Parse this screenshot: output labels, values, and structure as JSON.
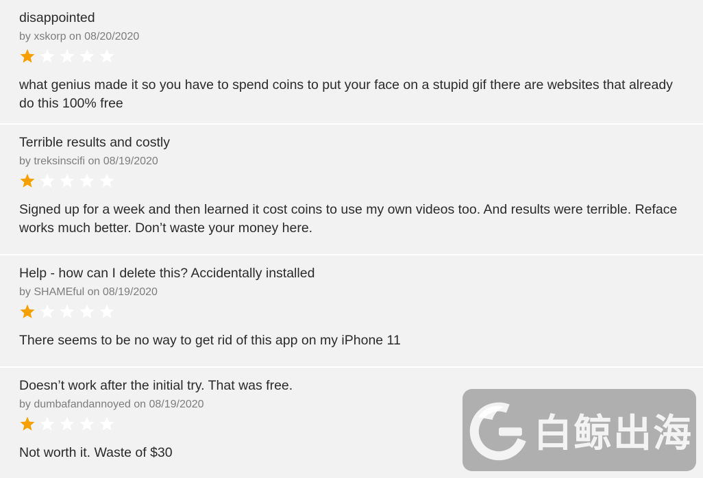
{
  "colors": {
    "star_filled": "#f59f00",
    "star_empty": "#ffffff",
    "card_bg": "#f2f2f2",
    "byline": "#7c7c7c",
    "text": "#2a2a2a"
  },
  "reviews": [
    {
      "title": "disappointed",
      "byline": "by xskorp on 08/20/2020",
      "rating": 1,
      "max_rating": 5,
      "body": "what genius made it so you have to spend coins to put your face on a stupid gif there are websites that already do this 100% free"
    },
    {
      "title": "Terrible results and costly",
      "byline": "by treksinscifi on 08/19/2020",
      "rating": 1,
      "max_rating": 5,
      "body": "Signed up for a week and then learned it cost coins to use my own videos too. And results were terrible. Reface works much better. Don’t waste your money here."
    },
    {
      "title": "Help - how can I delete this? Accidentally installed",
      "byline": "by SHAMEful on 08/19/2020",
      "rating": 1,
      "max_rating": 5,
      "body": "There seems to be no way to get rid of this app on my iPhone 11"
    },
    {
      "title": "Doesn’t work after the initial try. That was free.",
      "byline": "by dumbafandannoyed on 08/19/2020",
      "rating": 1,
      "max_rating": 5,
      "body": "Not worth it. Waste of $30"
    }
  ],
  "watermark": {
    "text": "白鲸出海",
    "logo_icon": "whale-g-logo-icon"
  }
}
